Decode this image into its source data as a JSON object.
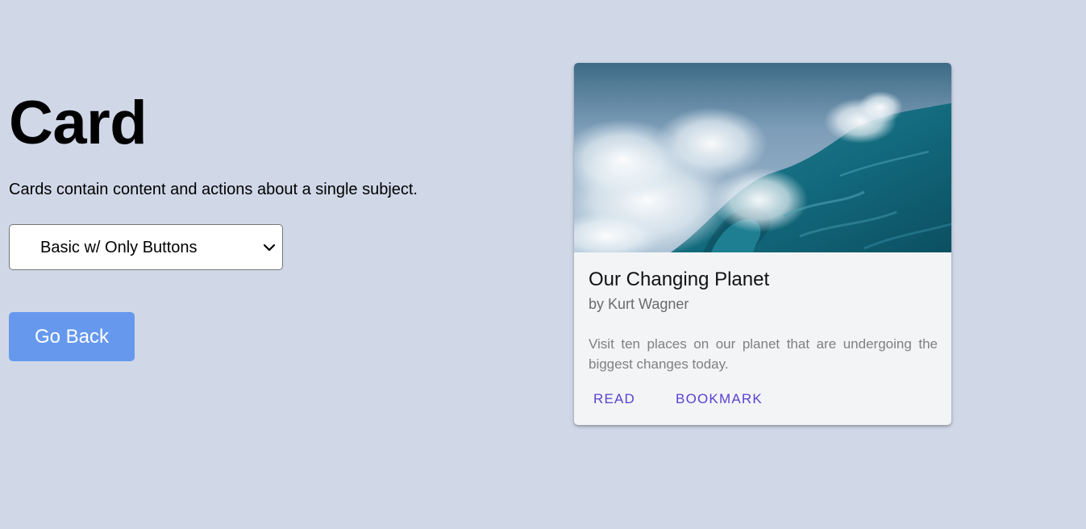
{
  "page": {
    "title": "Card",
    "subtitle": "Cards contain content and actions about a single subject.",
    "variant_select": {
      "selected": "Basic w/ Only Buttons"
    },
    "go_back_label": "Go Back"
  },
  "card": {
    "title": "Our Changing Planet",
    "author": "by Kurt Wagner",
    "description": "Visit ten places on our planet that are undergoing the biggest changes today.",
    "actions": {
      "read_label": "READ",
      "bookmark_label": "BOOKMARK"
    },
    "accent_color": "#5b3fd0"
  },
  "colors": {
    "background": "#d0d8e8",
    "button": "#6699ee",
    "card_surface": "#f2f4f6"
  },
  "icons": {
    "select_arrow": "chevron-down-icon"
  }
}
